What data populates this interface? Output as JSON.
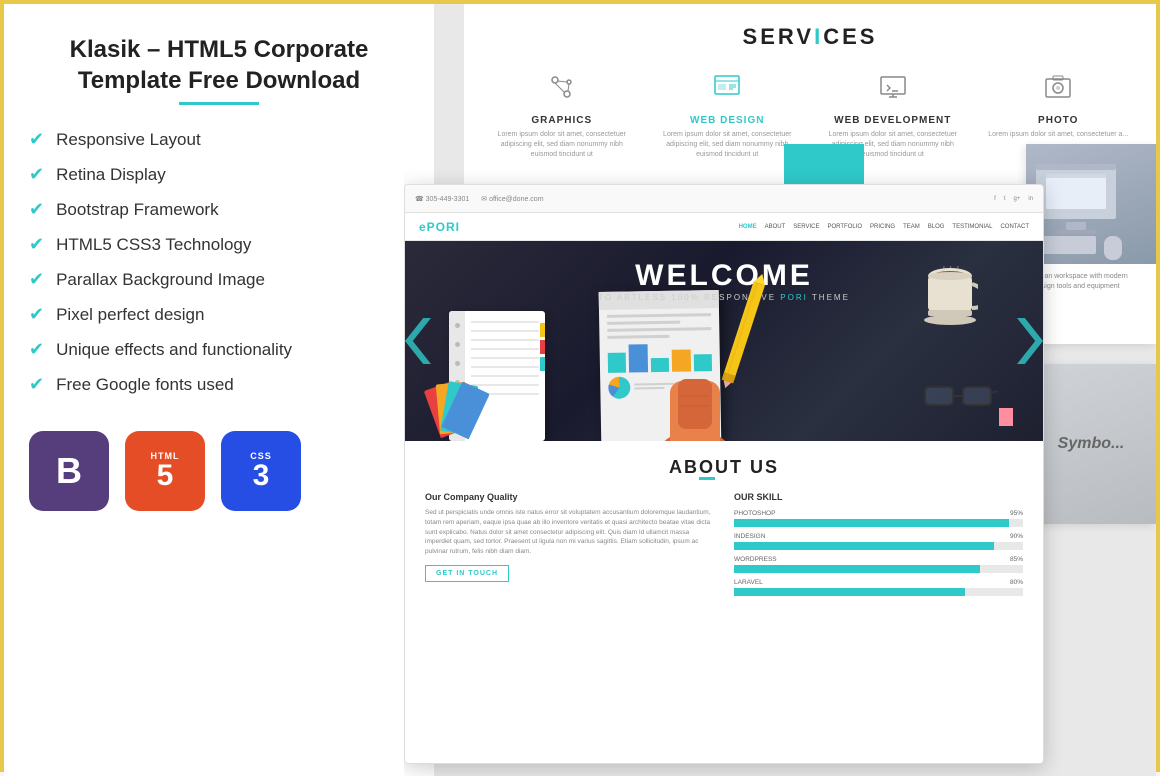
{
  "border_color": "#e8c84a",
  "left": {
    "title_line1": "Klasik – HTML5 Corporate",
    "title_line2": "Template Free Download",
    "features": [
      "Responsive Layout",
      "Retina Display",
      "Bootstrap Framework",
      "HTML5 CSS3 Technology",
      "Parallax Background Image",
      "Pixel perfect design",
      "Unique effects and functionality",
      "Free Google fonts used"
    ],
    "badges": [
      {
        "id": "bootstrap",
        "label": "B",
        "bg": "#563d7c"
      },
      {
        "id": "html5",
        "label": "HTML 5",
        "bg": "#e44d26"
      },
      {
        "id": "css3",
        "label": "CSS 3",
        "bg": "#264de4"
      }
    ]
  },
  "services": {
    "title_pre": "SERV",
    "title_accent": "I",
    "title_post": "CES",
    "items": [
      {
        "name": "GRAPHICS",
        "teal": false,
        "desc": "Lorem ipsum dolor sit amet, consectetuer adipiscing elit, sed diam nonummy nibh euismod tincidunt ut"
      },
      {
        "name": "WEB DESIGN",
        "teal": true,
        "desc": "Lorem ipsum dolor sit amet, consectetuer adipiscing elit, sed diam nonummy nibh euismod tincidunt ut"
      },
      {
        "name": "WEB DEVELOPMENT",
        "teal": false,
        "desc": "Lorem ipsum dolor sit amet, consectetuer adipiscing elit, sed diam nonummy nibh euismod tincidunt ut"
      },
      {
        "name": "PHOTO",
        "teal": false,
        "desc": "Lorem ipsum dolor sit amet, consectetuer a..."
      }
    ]
  },
  "mockup": {
    "nav_phone": "305-449-3301",
    "nav_email": "office@done.com",
    "logo": "ePORI",
    "nav_links": [
      "HOME",
      "ABOUT",
      "SERVICE",
      "PORTFOLIO",
      "PRICING",
      "TEAM",
      "BLOG",
      "TESTIMONIAL",
      "CONTACT"
    ],
    "hero_welcome": "WELCOME",
    "hero_sub": "TO ARTLESS 100% RESPONSIVE",
    "hero_brand": "PORI",
    "hero_theme": "THEME",
    "about_title": "AB",
    "about_title_u": "O",
    "about_title_rest": "UT US",
    "about_company_quality": "Our Company Quality",
    "about_text": "Sed ut perspiciatis unde omnis iste natus error sit voluptatem accusantium doloremque laudantium, totam rem aperiam, eaque ipsa quae ab illo inventore veritatis et quasi architecto beatae vitae dicta sunt explicabo. Natus dolor sit amet consectetur adipiscing elit. Quis diam Id ullamcit massa imperdiet quam, sed tortor. Praesent ut ligula non mi varius sagittis. Etiam sollicitudin, ipsum ac pulvinar rutrum, felis nibh diam diam.",
    "get_in_touch": "GET IN TOUCH",
    "our_skill": "OUR SKILL",
    "skills": [
      {
        "name": "PHOTOSHOP",
        "pct": 95
      },
      {
        "name": "INDESIGN",
        "pct": 90
      },
      {
        "name": "WORDPRESS",
        "pct": 85
      },
      {
        "name": "LARAVEL",
        "pct": 80
      }
    ]
  }
}
